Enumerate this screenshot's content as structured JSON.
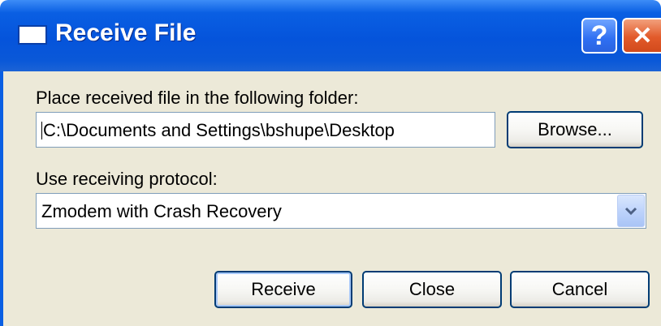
{
  "window": {
    "title": "Receive File",
    "help_symbol": "?",
    "close_symbol": "✕",
    "icon": "window-icon"
  },
  "folder": {
    "label": "Place received file in the following folder:",
    "value": "C:\\Documents and Settings\\bshupe\\Desktop",
    "browse_label": "Browse..."
  },
  "protocol": {
    "label": "Use receiving protocol:",
    "selected": "Zmodem with Crash Recovery",
    "dropdown_icon": "chevron-down-icon"
  },
  "buttons": {
    "receive": "Receive",
    "close": "Close",
    "cancel": "Cancel"
  },
  "colors": {
    "titlebar": "#0a5fe3",
    "dialog_bg": "#ece9d8",
    "button_border": "#003c74",
    "close_button": "#e25a2a"
  }
}
